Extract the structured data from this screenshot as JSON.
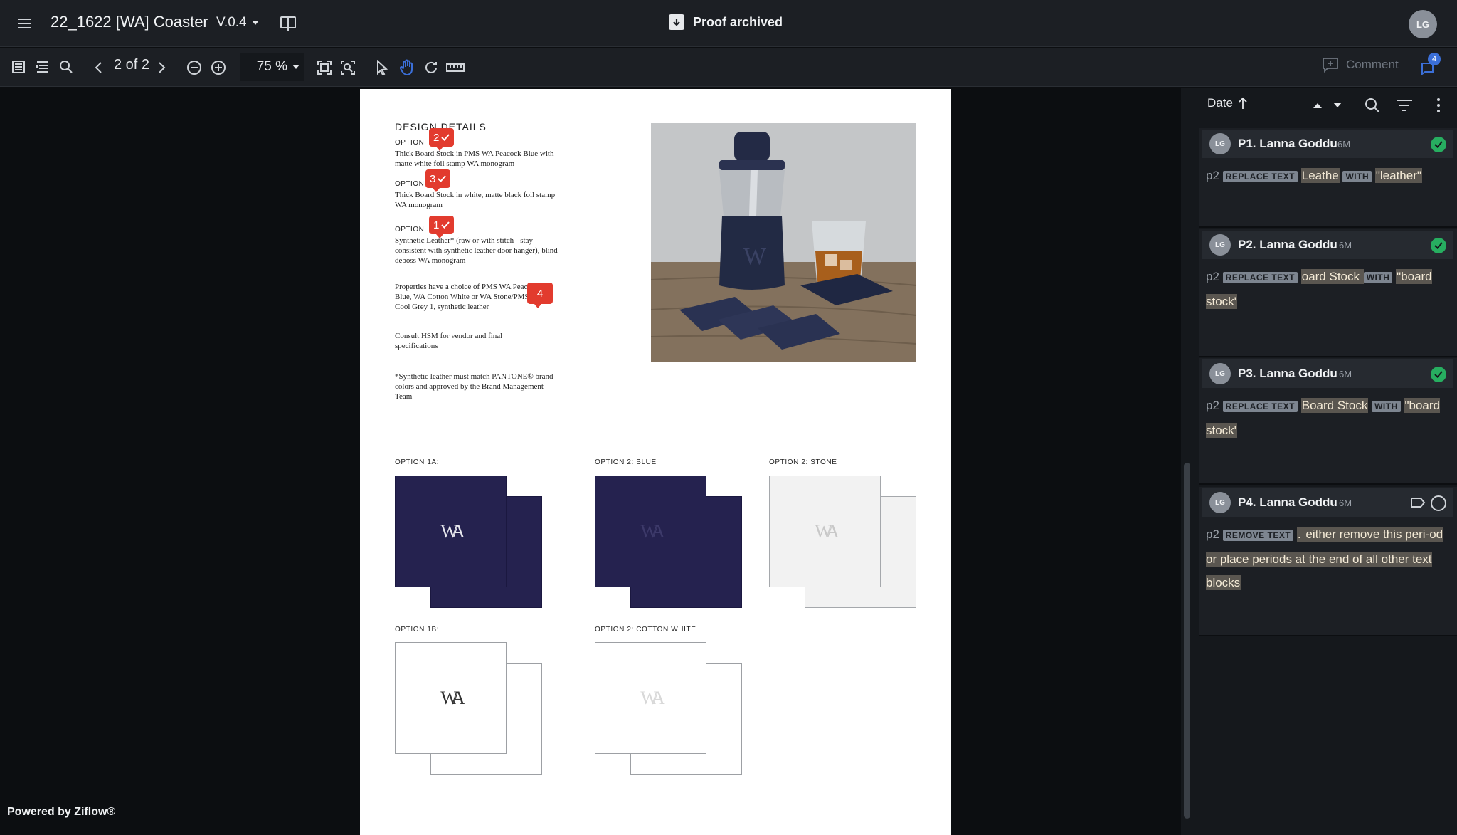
{
  "header": {
    "title": "22_1622 [WA] Coaster",
    "version": "V.0.4",
    "proof_status": "Proof archived",
    "user_initials": "LG"
  },
  "toolbar": {
    "page_indicator": "2 of 2",
    "zoom_value": "75 %",
    "comment_label": "Comment",
    "comment_badge": "4"
  },
  "document": {
    "section_title": "DESIGN DETAILS",
    "options": [
      {
        "label": "OPTION",
        "text": "Thick Board Stock in PMS WA Peacock Blue with matte white foil stamp WA monogram"
      },
      {
        "label": "OPTION",
        "text": "Thick Board Stock in white, matte black foil stamp WA monogram"
      },
      {
        "label": "OPTION",
        "text": "Synthetic Leather* (raw or with stitch - stay consistent with synthetic leather door hanger), blind deboss WA monogram"
      }
    ],
    "properties_text": "Properties have a choice of PMS WA Peacock Blue, WA Cotton White or WA Stone/PMS Cool Grey 1, synthetic leather",
    "consult_text": "Consult HSM for vendor and final specifications",
    "footnote_text": "*Synthetic leather must match PANTONE® brand colors and approved by the Brand Management Team",
    "markers": [
      "2",
      "3",
      "1",
      "4"
    ],
    "swatches": [
      {
        "label": "OPTION 1A:",
        "monogram": "WA"
      },
      {
        "label": "OPTION 2: BLUE",
        "monogram": "WA"
      },
      {
        "label": "OPTION 2: STONE",
        "monogram": "WA"
      },
      {
        "label": "OPTION 1B:",
        "monogram": "WA"
      },
      {
        "label": "OPTION 2: COTTON WHITE",
        "monogram": "WA"
      }
    ],
    "photo_monogram": "W"
  },
  "footer": {
    "powered_by": "Powered by Ziflow®"
  },
  "panel": {
    "sort_label": "Date",
    "comments": [
      {
        "initials": "LG",
        "title": "P1. Lanna Goddu",
        "time": "6M",
        "page": "p2",
        "action": "REPLACE TEXT",
        "old": "Leathe",
        "with": "WITH",
        "new": "\"leather\""
      },
      {
        "initials": "LG",
        "title": "P2. Lanna Goddu",
        "time": "6M",
        "page": "p2",
        "action": "REPLACE TEXT",
        "old": "oard Stock ",
        "with": "WITH",
        "new": "\"board stock'"
      },
      {
        "initials": "LG",
        "title": "P3. Lanna Goddu",
        "time": "6M",
        "page": "p2",
        "action": "REPLACE TEXT",
        "old": "Board Stock",
        "with": "WITH",
        "new": "\"board stock'"
      },
      {
        "initials": "LG",
        "title": "P4. Lanna Goddu",
        "time": "6M",
        "page": "p2",
        "action": "REMOVE TEXT",
        "old": ".",
        "new": " either remove this peri-od or place periods at the end of all other text blocks"
      }
    ]
  },
  "colors": {
    "accent": "#3b6fd8",
    "marker": "#e23b2e",
    "navy": "#25224f",
    "resolved": "#27ae60"
  }
}
